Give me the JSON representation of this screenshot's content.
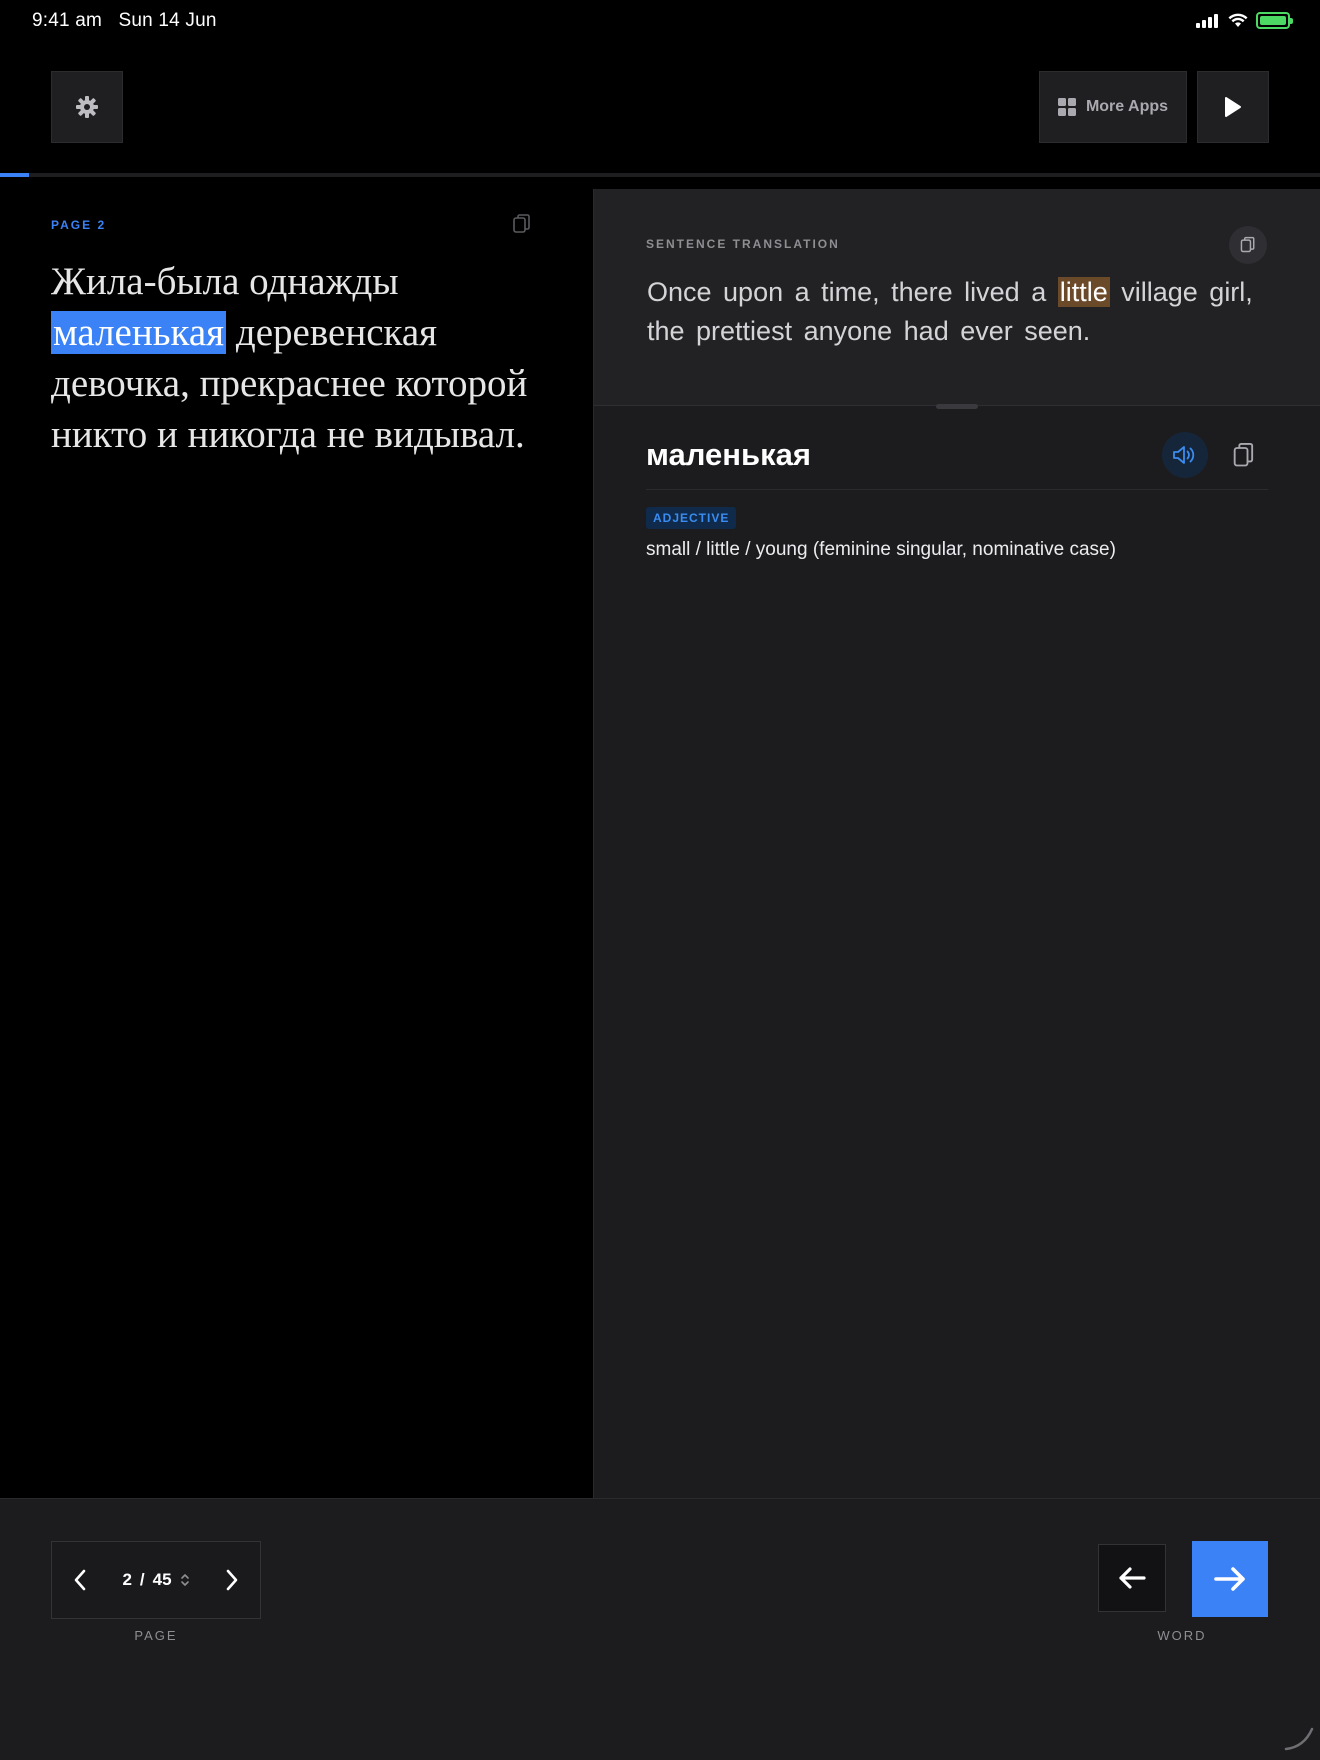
{
  "status_bar": {
    "time": "9:41 am",
    "date": "Sun 14 Jun",
    "battery_color": "#4cd964"
  },
  "toolbar": {
    "settings_icon": "gear-icon",
    "more_apps_label": "More Apps",
    "more_apps_icon": "grid-icon",
    "play_icon": "play-icon"
  },
  "reading": {
    "page_label": "PAGE 2",
    "text_before": "Жила-была однажды ",
    "highlighted_word": "маленькая",
    "text_after": " деревенская девочка, прекраснее которой никто и никогда не видывал."
  },
  "translation": {
    "section_label": "SENTENCE TRANSLATION",
    "text_before": "Once upon a time, there lived a ",
    "highlighted_word": "little",
    "text_after": " village girl, the prettiest anyone had ever seen."
  },
  "word_detail": {
    "word": "маленькая",
    "part_of_speech": "ADJECTIVE",
    "definition": "small / little / young (feminine singular, nominative case)"
  },
  "pager": {
    "current_page": "2",
    "separator": "/",
    "total_pages": "45",
    "caption": "PAGE"
  },
  "word_nav": {
    "caption": "WORD"
  },
  "reading_progress": 0.022,
  "colors": {
    "accent": "#3b82f6",
    "translation_highlight": "#6b4a2a",
    "panel_bg": "#1c1c1e"
  }
}
